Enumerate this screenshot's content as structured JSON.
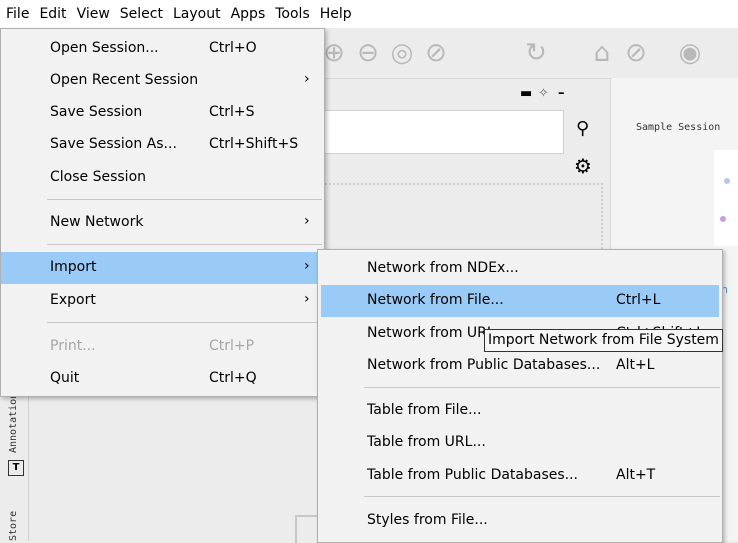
{
  "menubar": {
    "items": [
      "File",
      "Edit",
      "View",
      "Select",
      "Layout",
      "Apps",
      "Tools",
      "Help"
    ]
  },
  "file_menu": {
    "items": [
      {
        "label": "Open Session...",
        "accel": "Ctrl+O",
        "submenu": false
      },
      {
        "label": "Open Recent Session",
        "accel": "",
        "submenu": true
      },
      {
        "label": "Save Session",
        "accel": "Ctrl+S",
        "submenu": false
      },
      {
        "label": "Save Session As...",
        "accel": "Ctrl+Shift+S",
        "submenu": false
      },
      {
        "label": "Close Session",
        "accel": "",
        "submenu": false
      },
      {
        "label": "New Network",
        "accel": "",
        "submenu": true
      },
      {
        "label": "Import",
        "accel": "",
        "submenu": true
      },
      {
        "label": "Export",
        "accel": "",
        "submenu": true
      },
      {
        "label": "Print...",
        "accel": "Ctrl+P",
        "submenu": false,
        "disabled": true
      },
      {
        "label": "Quit",
        "accel": "Ctrl+Q",
        "submenu": false
      }
    ]
  },
  "import_menu": {
    "items": [
      {
        "label": "Network from NDEx...",
        "accel": ""
      },
      {
        "label": "Network from File...",
        "accel": "Ctrl+L"
      },
      {
        "label": "Network from URL...",
        "accel": "Ctrl+Shift+L"
      },
      {
        "label": "Network from Public Databases...",
        "accel": "Alt+L"
      },
      {
        "label": "Table from File...",
        "accel": ""
      },
      {
        "label": "Table from URL...",
        "accel": ""
      },
      {
        "label": "Table from Public Databases...",
        "accel": "Alt+T"
      },
      {
        "label": "Styles from File...",
        "accel": ""
      }
    ]
  },
  "tooltip": {
    "text": "Import Network from File System"
  },
  "background": {
    "sample_label": "Sample Session",
    "side_tab_annotation": "Annotation",
    "side_tab_store": "Store",
    "annotation_icon_text": "T",
    "blue_text": "in"
  },
  "colors": {
    "highlight": "#99cbf6",
    "menu_bg": "#f2f2f2"
  }
}
